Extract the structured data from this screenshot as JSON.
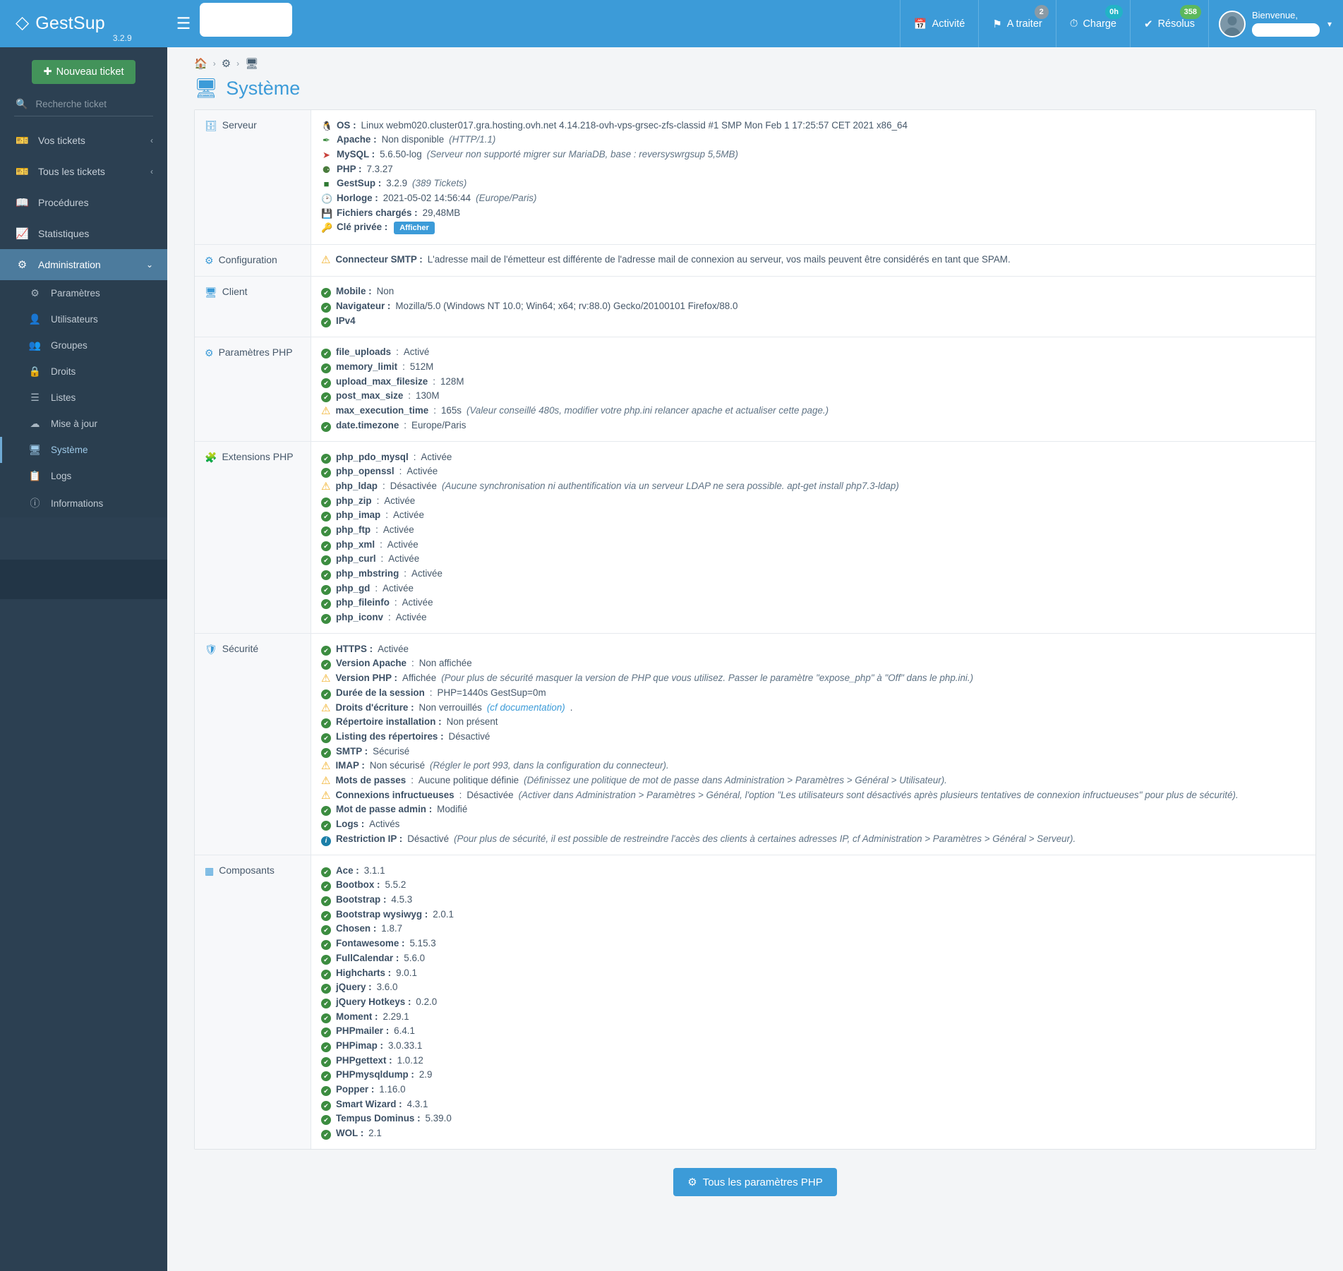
{
  "brand": {
    "name": "GestSup",
    "version": "3.2.9",
    "logo_icon": "diamond-logo-icon"
  },
  "topnav": {
    "hamburger_icon": "hamburger-menu-icon",
    "items": [
      {
        "label": "Activité",
        "icon": "calendar-icon",
        "badge": null,
        "badge_color": ""
      },
      {
        "label": "A traiter",
        "icon": "flag-icon",
        "badge": "2",
        "badge_color": "#8a9aa5"
      },
      {
        "label": "Charge",
        "icon": "gauge-icon",
        "badge": "0h",
        "badge_color": "#22b3c6"
      },
      {
        "label": "Résolus",
        "icon": "check-icon",
        "badge": "358",
        "badge_color": "#5cb85c"
      }
    ],
    "welcome": "Bienvenue,"
  },
  "sidebar": {
    "new_ticket": "Nouveau ticket",
    "search_placeholder": "Recherche ticket",
    "items": [
      {
        "label": "Vos tickets",
        "icon": "ticket-icon",
        "chevron": "‹"
      },
      {
        "label": "Tous les tickets",
        "icon": "ticket-icon",
        "chevron": "‹"
      },
      {
        "label": "Procédures",
        "icon": "book-icon",
        "chevron": ""
      },
      {
        "label": "Statistiques",
        "icon": "chart-icon",
        "chevron": ""
      },
      {
        "label": "Administration",
        "icon": "gears-icon",
        "chevron": "⌄"
      }
    ],
    "subitems": [
      {
        "label": "Paramètres",
        "icon": "gear-icon"
      },
      {
        "label": "Utilisateurs",
        "icon": "user-icon"
      },
      {
        "label": "Groupes",
        "icon": "users-icon"
      },
      {
        "label": "Droits",
        "icon": "lock-icon"
      },
      {
        "label": "Listes",
        "icon": "list-icon"
      },
      {
        "label": "Mise à jour",
        "icon": "cloud-upload-icon"
      },
      {
        "label": "Système",
        "icon": "desktop-icon"
      },
      {
        "label": "Logs",
        "icon": "clipboard-icon"
      },
      {
        "label": "Informations",
        "icon": "info-circle-icon"
      }
    ]
  },
  "breadcrumb": [
    {
      "icon": "home-icon"
    },
    {
      "icon": "gears-icon"
    },
    {
      "icon": "desktop-icon"
    }
  ],
  "page": {
    "title": "Système",
    "title_icon": "desktop-icon"
  },
  "sections": {
    "serveur": {
      "label": "Serveur",
      "icon": "server-icon",
      "lines": [
        {
          "icon": "linux-icon",
          "icon_class": "linux",
          "label": "OS :",
          "value": "Linux webm020.cluster017.gra.hosting.ovh.net 4.14.218-ovh-vps-grsec-zfs-classid #1 SMP Mon Feb 1 17:25:57 CET 2021 x86_64",
          "note": ""
        },
        {
          "icon": "apache-feather-icon",
          "icon_class": "apache",
          "label": "Apache :",
          "value": "Non disponible",
          "note": "(HTTP/1.1)"
        },
        {
          "icon": "mysql-dolphin-icon",
          "icon_class": "mysql",
          "label": "MySQL :",
          "value": "5.6.50-log",
          "note": "(Serveur non supporté migrer sur MariaDB, base : reversyswrgsup 5,5MB)"
        },
        {
          "icon": "php-icon",
          "icon_class": "php",
          "label": "PHP :",
          "value": "7.3.27",
          "note": ""
        },
        {
          "icon": "gestsup-icon",
          "icon_class": "gestsup",
          "label": "GestSup :",
          "value": "3.2.9",
          "note": "(389 Tickets)"
        },
        {
          "icon": "clock-icon",
          "icon_class": "clock",
          "label": "Horloge :",
          "value": "2021-05-02 14:56:44",
          "note": "(Europe/Paris)"
        },
        {
          "icon": "hdd-icon",
          "icon_class": "hdd",
          "label": "Fichiers chargés :",
          "value": "29,48MB",
          "note": ""
        },
        {
          "icon": "key-icon",
          "icon_class": "key",
          "label": "Clé privée :",
          "value": "",
          "note": "",
          "button": "Afficher"
        }
      ]
    },
    "configuration": {
      "label": "Configuration",
      "icon": "gear-icon",
      "lines": [
        {
          "status": "warn",
          "label": "Connecteur SMTP :",
          "value": "L'adresse mail de l'émetteur est différente de l'adresse mail de connexion au serveur, vos mails peuvent être considérés en tant que SPAM.",
          "note": ""
        }
      ]
    },
    "client": {
      "label": "Client",
      "icon": "desktop-icon",
      "lines": [
        {
          "status": "ok",
          "label": "Mobile :",
          "value": "Non",
          "note": ""
        },
        {
          "status": "ok",
          "label": "Navigateur :",
          "value": "Mozilla/5.0 (Windows NT 10.0; Win64; x64; rv:88.0) Gecko/20100101 Firefox/88.0",
          "note": ""
        },
        {
          "status": "ok",
          "label": "IPv4",
          "value": "",
          "note": ""
        }
      ]
    },
    "parametres_php": {
      "label": "Paramètres PHP",
      "icon": "gear-icon",
      "lines": [
        {
          "status": "ok",
          "label": "file_uploads",
          "sep": ":",
          "value": "Activé",
          "note": ""
        },
        {
          "status": "ok",
          "label": "memory_limit",
          "sep": ":",
          "value": "512M",
          "note": ""
        },
        {
          "status": "ok",
          "label": "upload_max_filesize",
          "sep": ":",
          "value": "128M",
          "note": ""
        },
        {
          "status": "ok",
          "label": "post_max_size",
          "sep": ":",
          "value": "130M",
          "note": ""
        },
        {
          "status": "warn",
          "label": "max_execution_time",
          "sep": ":",
          "value": "165s",
          "note": "(Valeur conseillé 480s, modifier votre php.ini relancer apache et actualiser cette page.)"
        },
        {
          "status": "ok",
          "label": "date.timezone",
          "sep": ":",
          "value": "Europe/Paris",
          "note": ""
        }
      ]
    },
    "extensions_php": {
      "label": "Extensions PHP",
      "icon": "puzzle-icon",
      "lines": [
        {
          "status": "ok",
          "label": "php_pdo_mysql",
          "sep": ":",
          "value": "Activée",
          "note": ""
        },
        {
          "status": "ok",
          "label": "php_openssl",
          "sep": ":",
          "value": "Activée",
          "note": ""
        },
        {
          "status": "warn",
          "label": "php_ldap",
          "sep": ":",
          "value": "Désactivée",
          "note": "(Aucune synchronisation ni authentification via un serveur LDAP ne sera possible. apt-get install php7.3-ldap)"
        },
        {
          "status": "ok",
          "label": "php_zip",
          "sep": ":",
          "value": "Activée",
          "note": ""
        },
        {
          "status": "ok",
          "label": "php_imap",
          "sep": ":",
          "value": "Activée",
          "note": ""
        },
        {
          "status": "ok",
          "label": "php_ftp",
          "sep": ":",
          "value": "Activée",
          "note": ""
        },
        {
          "status": "ok",
          "label": "php_xml",
          "sep": ":",
          "value": "Activée",
          "note": ""
        },
        {
          "status": "ok",
          "label": "php_curl",
          "sep": ":",
          "value": "Activée",
          "note": ""
        },
        {
          "status": "ok",
          "label": "php_mbstring",
          "sep": ":",
          "value": "Activée",
          "note": ""
        },
        {
          "status": "ok",
          "label": "php_gd",
          "sep": ":",
          "value": "Activée",
          "note": ""
        },
        {
          "status": "ok",
          "label": "php_fileinfo",
          "sep": ":",
          "value": "Activée",
          "note": ""
        },
        {
          "status": "ok",
          "label": "php_iconv",
          "sep": ":",
          "value": "Activée",
          "note": ""
        }
      ]
    },
    "securite": {
      "label": "Sécurité",
      "icon": "shield-icon",
      "lines": [
        {
          "status": "ok",
          "label": "HTTPS :",
          "value": "Activée",
          "note": ""
        },
        {
          "status": "ok",
          "label": "Version Apache",
          "sep": ":",
          "value": "Non affichée",
          "note": ""
        },
        {
          "status": "warn",
          "label": "Version PHP :",
          "value": "Affichée",
          "note": "(Pour plus de sécurité masquer la version de PHP que vous utilisez. Passer le paramètre \"expose_php\" à \"Off\" dans le php.ini.)"
        },
        {
          "status": "ok",
          "label": "Durée de la session",
          "sep": ":",
          "value": "PHP=1440s GestSup=0m",
          "note": ""
        },
        {
          "status": "warn",
          "label": "Droits d'écriture :",
          "value": "Non verrouillés",
          "note": "(cf documentation)",
          "note_link": true,
          "suffix": "."
        },
        {
          "status": "ok",
          "label": "Répertoire installation :",
          "value": "Non présent",
          "note": ""
        },
        {
          "status": "ok",
          "label": "Listing des répertoires :",
          "value": "Désactivé",
          "note": ""
        },
        {
          "status": "ok",
          "label": "SMTP :",
          "value": "Sécurisé",
          "note": ""
        },
        {
          "status": "warn",
          "label": "IMAP :",
          "value": "Non sécurisé",
          "note": "(Régler le port 993, dans la configuration du connecteur)."
        },
        {
          "status": "warn",
          "label": "Mots de passes",
          "sep": ":",
          "value": "Aucune politique définie",
          "note": "(Définissez une politique de mot de passe dans Administration > Paramètres > Général > Utilisateur)."
        },
        {
          "status": "warn",
          "label": "Connexions infructueuses",
          "sep": ":",
          "value": "Désactivée",
          "note": "(Activer dans Administration > Paramètres > Général, l'option \"Les utilisateurs sont désactivés après plusieurs tentatives de connexion infructueuses\" pour plus de sécurité)."
        },
        {
          "status": "ok",
          "label": "Mot de passe admin :",
          "value": "Modifié",
          "note": ""
        },
        {
          "status": "ok",
          "label": "Logs :",
          "value": "Activés",
          "note": ""
        },
        {
          "status": "info",
          "label": "Restriction IP :",
          "value": "Désactivé",
          "note": "(Pour plus de sécurité, il est possible de restreindre l'accès des clients à certaines adresses IP, cf Administration > Paramètres > Général > Serveur)."
        }
      ]
    },
    "composants": {
      "label": "Composants",
      "icon": "cubes-icon",
      "lines": [
        {
          "status": "ok",
          "label": "Ace :",
          "value": "3.1.1"
        },
        {
          "status": "ok",
          "label": "Bootbox :",
          "value": "5.5.2"
        },
        {
          "status": "ok",
          "label": "Bootstrap :",
          "value": "4.5.3"
        },
        {
          "status": "ok",
          "label": "Bootstrap wysiwyg :",
          "value": "2.0.1"
        },
        {
          "status": "ok",
          "label": "Chosen :",
          "value": "1.8.7"
        },
        {
          "status": "ok",
          "label": "Fontawesome :",
          "value": "5.15.3"
        },
        {
          "status": "ok",
          "label": "FullCalendar :",
          "value": "5.6.0"
        },
        {
          "status": "ok",
          "label": "Highcharts :",
          "value": "9.0.1"
        },
        {
          "status": "ok",
          "label": "jQuery :",
          "value": "3.6.0"
        },
        {
          "status": "ok",
          "label": "jQuery Hotkeys :",
          "value": "0.2.0"
        },
        {
          "status": "ok",
          "label": "Moment :",
          "value": "2.29.1"
        },
        {
          "status": "ok",
          "label": "PHPmailer :",
          "value": "6.4.1"
        },
        {
          "status": "ok",
          "label": "PHPimap :",
          "value": "3.0.33.1"
        },
        {
          "status": "ok",
          "label": "PHPgettext :",
          "value": "1.0.12"
        },
        {
          "status": "ok",
          "label": "PHPmysqldump :",
          "value": "2.9"
        },
        {
          "status": "ok",
          "label": "Popper :",
          "value": "1.16.0"
        },
        {
          "status": "ok",
          "label": "Smart Wizard :",
          "value": "4.3.1"
        },
        {
          "status": "ok",
          "label": "Tempus Dominus :",
          "value": "5.39.0"
        },
        {
          "status": "ok",
          "label": "WOL :",
          "value": "2.1"
        }
      ]
    }
  },
  "footer": {
    "php_params_button": "Tous les paramètres PHP",
    "php_params_icon": "gears-icon"
  },
  "colors": {
    "brand_blue": "#3c9bd8",
    "sidebar_dark": "#2c4052",
    "green": "#43935a",
    "warn": "#f0ad20",
    "ok": "#3c8c40"
  }
}
